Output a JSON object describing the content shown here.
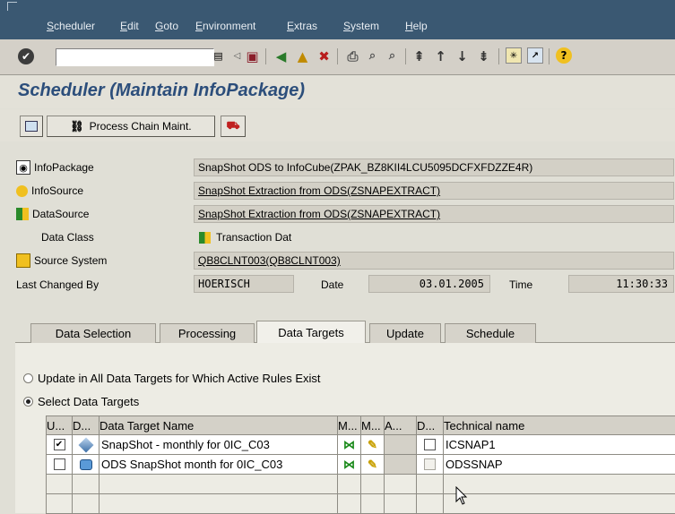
{
  "menu": [
    "Scheduler",
    "Edit",
    "Goto",
    "Environment",
    "Extras",
    "System",
    "Help"
  ],
  "toolbar": {
    "command_field": "",
    "icons": [
      "enter-icon",
      "save-icon",
      "back-icon",
      "exit-icon",
      "cancel-icon",
      "print-icon",
      "find-icon",
      "find-next-icon",
      "first-page-icon",
      "previous-page-icon",
      "next-page-icon",
      "last-page-icon",
      "create-session-icon",
      "shortcut-icon",
      "help-icon"
    ]
  },
  "page_title": "Scheduler (Maintain InfoPackage)",
  "app_toolbar": {
    "process_chain_label": "Process Chain Maint."
  },
  "header": {
    "infopackage_label": "InfoPackage",
    "infopackage_value": "SnapShot ODS to InfoCube(ZPAK_BZ8KII4LCU5095DCFXFDZZE4R)",
    "infosource_label": "InfoSource",
    "infosource_value": "SnapShot Extraction from ODS(ZSNAPEXTRACT)",
    "datasource_label": "DataSource",
    "datasource_value": "SnapShot Extraction from ODS(ZSNAPEXTRACT)",
    "dataclass_label": "Data Class",
    "dataclass_value": "Transaction Dat",
    "sourcesystem_label": "Source System",
    "sourcesystem_value": "QB8CLNT003(QB8CLNT003)",
    "lastchanged_label": "Last Changed By",
    "lastchanged_value": "HOERISCH",
    "date_label": "Date",
    "date_value": "03.01.2005",
    "time_label": "Time",
    "time_value": "11:30:33"
  },
  "tabs": [
    "Data Selection",
    "Processing",
    "Data Targets",
    "Update",
    "Schedule"
  ],
  "active_tab": "Data Targets",
  "options": {
    "update_all": "Update in All Data Targets for Which Active Rules Exist",
    "select_targets": "Select Data Targets",
    "selected": "select_targets"
  },
  "table": {
    "headers": [
      "U...",
      "D...",
      "Data Target Name",
      "M...",
      "M...",
      "A...",
      "D...",
      "Technical name"
    ],
    "rows": [
      {
        "checked": true,
        "name": "SnapShot - monthly for 0IC_C03",
        "technical": "ICSNAP1"
      },
      {
        "checked": false,
        "name": "ODS SnapShot month for 0IC_C03",
        "technical": "ODSSNAP"
      }
    ]
  },
  "colors": {
    "menubar": "#3a5872",
    "title": "#2c4e7b"
  }
}
